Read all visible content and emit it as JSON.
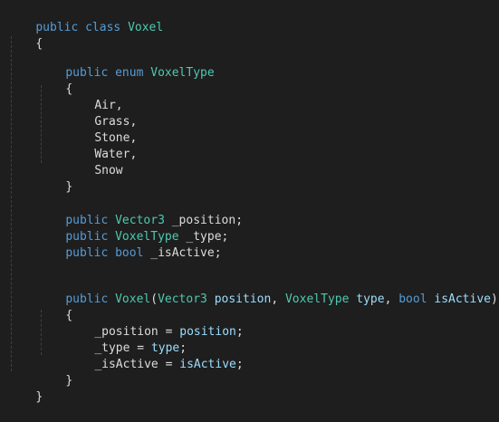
{
  "code": {
    "tokens": {
      "public": "public",
      "class": "class",
      "enum": "enum",
      "bool": "bool",
      "class_name": "Voxel",
      "enum_name": "VoxelType",
      "vector3": "Vector3",
      "field_position": "_position",
      "field_type": "_type",
      "field_isactive": "_isActive",
      "param_position": "position",
      "param_type": "type",
      "param_isactive": "isActive",
      "open_brace": "{",
      "close_brace": "}",
      "semicolon": ";",
      "comma": ",",
      "equals": " = ",
      "open_paren": "(",
      "close_paren": ")",
      "members": [
        "Air",
        "Grass",
        "Stone",
        "Water",
        "Snow"
      ]
    }
  },
  "colors": {
    "background": "#1e1e1e",
    "keyword": "#569cd6",
    "type": "#4ec9b0",
    "method": "#dcdcaa",
    "parameter": "#9cdcfe",
    "text": "#dcdcdc"
  }
}
